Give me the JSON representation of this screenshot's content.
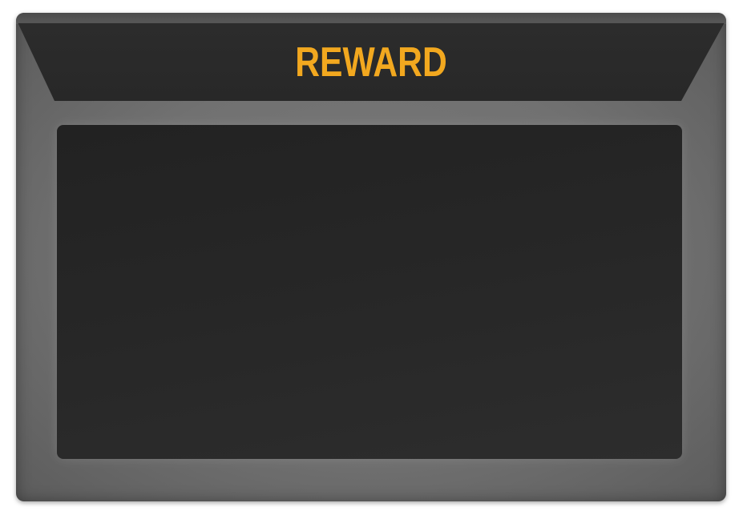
{
  "panel": {
    "title": "REWARD",
    "colors": {
      "title": "#f2a81f",
      "frame": "#717171",
      "header_band": "#2a2a2a",
      "content_area": "#262626"
    }
  }
}
